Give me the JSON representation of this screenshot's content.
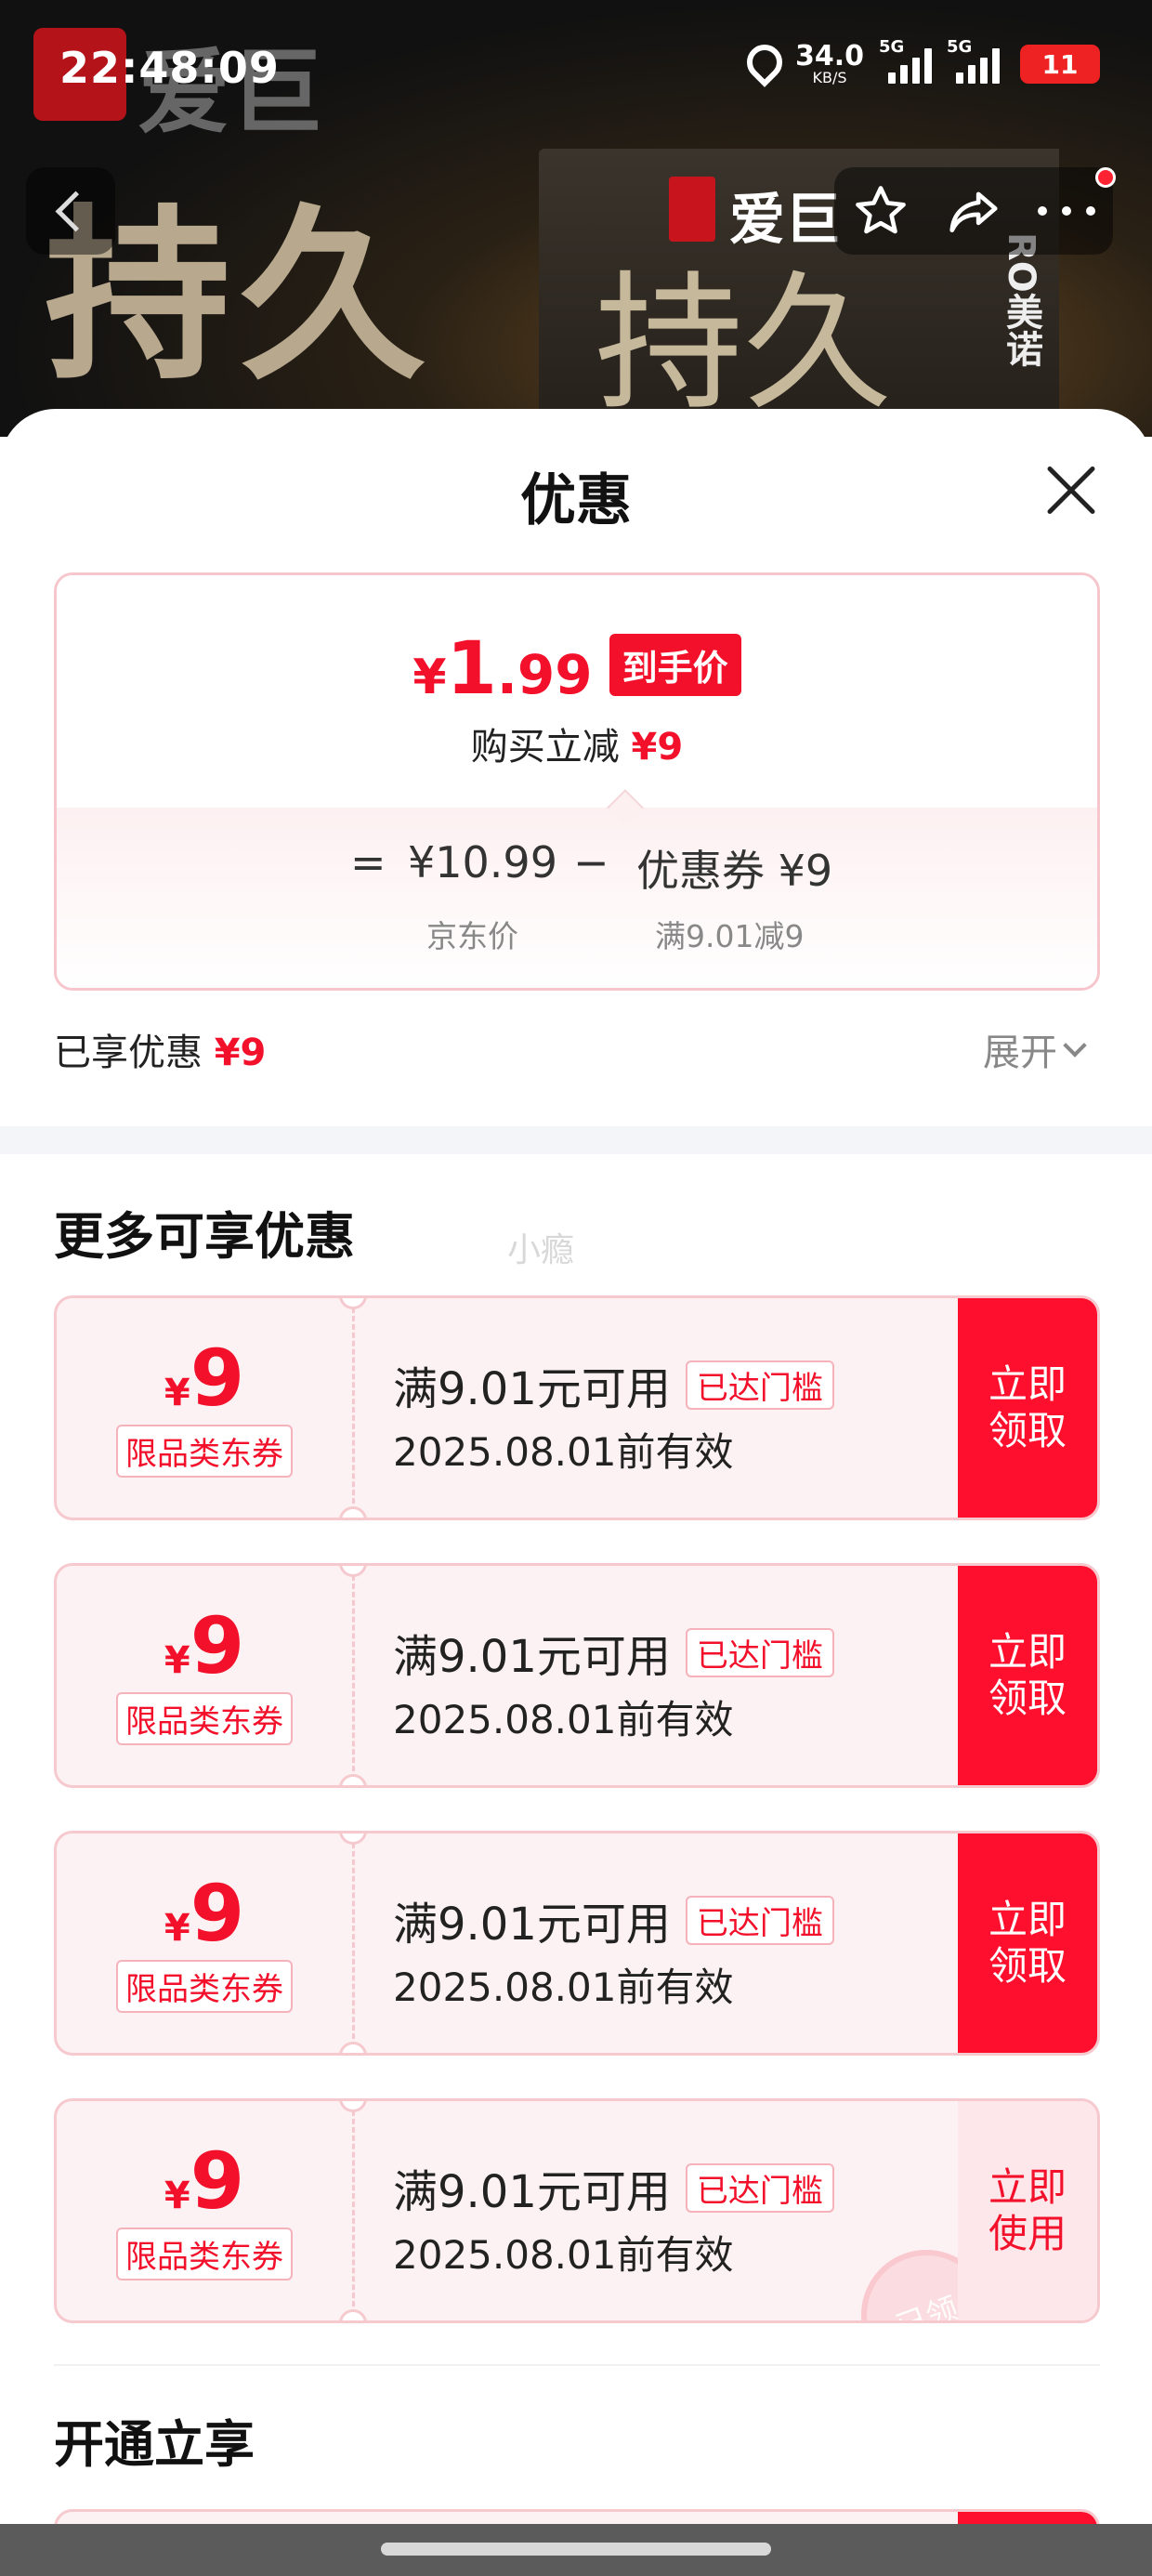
{
  "status_bar": {
    "time": "22:48:09",
    "net_speed": "34.0",
    "net_unit": "KB/S",
    "sig1_label": "5G",
    "sig2_label": "5G",
    "battery": "11"
  },
  "banner": {
    "bg_text": "爱巨",
    "big_text": "持久",
    "box_brand": "爱巨",
    "box_text": "持久",
    "box_side": "RO美诺"
  },
  "sheet": {
    "title": "优惠"
  },
  "price_card": {
    "currency": "¥",
    "price_int": "1",
    "price_dec": ".99",
    "final_tag": "到手价",
    "save_label": "购买立减 ",
    "save_amount": "¥9",
    "eq": "=",
    "jd_price": "¥10.99",
    "minus": "−",
    "coupon_part": "优惠券 ¥9",
    "jd_price_label": "京东价",
    "coupon_rule": "满9.01减9"
  },
  "enjoyed": {
    "label": "已享优惠 ",
    "amount": "¥9",
    "expand": "展开"
  },
  "more_section": {
    "title": "更多可享优惠",
    "watermark": "小瘾"
  },
  "coupons": [
    {
      "currency": "¥",
      "amount": "9",
      "type": "限品类东券",
      "condition": "满9.01元可用",
      "badge": "已达门槛",
      "validity": "2025.08.01前有效",
      "button": "立即\n领取"
    },
    {
      "currency": "¥",
      "amount": "9",
      "type": "限品类东券",
      "condition": "满9.01元可用",
      "badge": "已达门槛",
      "validity": "2025.08.01前有效",
      "button": "立即\n领取"
    },
    {
      "currency": "¥",
      "amount": "9",
      "type": "限品类东券",
      "condition": "满9.01元可用",
      "badge": "已达门槛",
      "validity": "2025.08.01前有效",
      "button": "立即\n领取"
    },
    {
      "currency": "¥",
      "amount": "9",
      "type": "限品类东券",
      "condition": "满9.01元可用",
      "badge": "已达门槛",
      "validity": "2025.08.01前有效",
      "button": "立即\n使用",
      "stamp": "已领"
    }
  ],
  "open_section": {
    "title": "开通立享"
  },
  "colors": {
    "accent_red": "#f2102b",
    "button_red": "#fe0f2d",
    "coupon_bg": "#fdf2f3"
  }
}
